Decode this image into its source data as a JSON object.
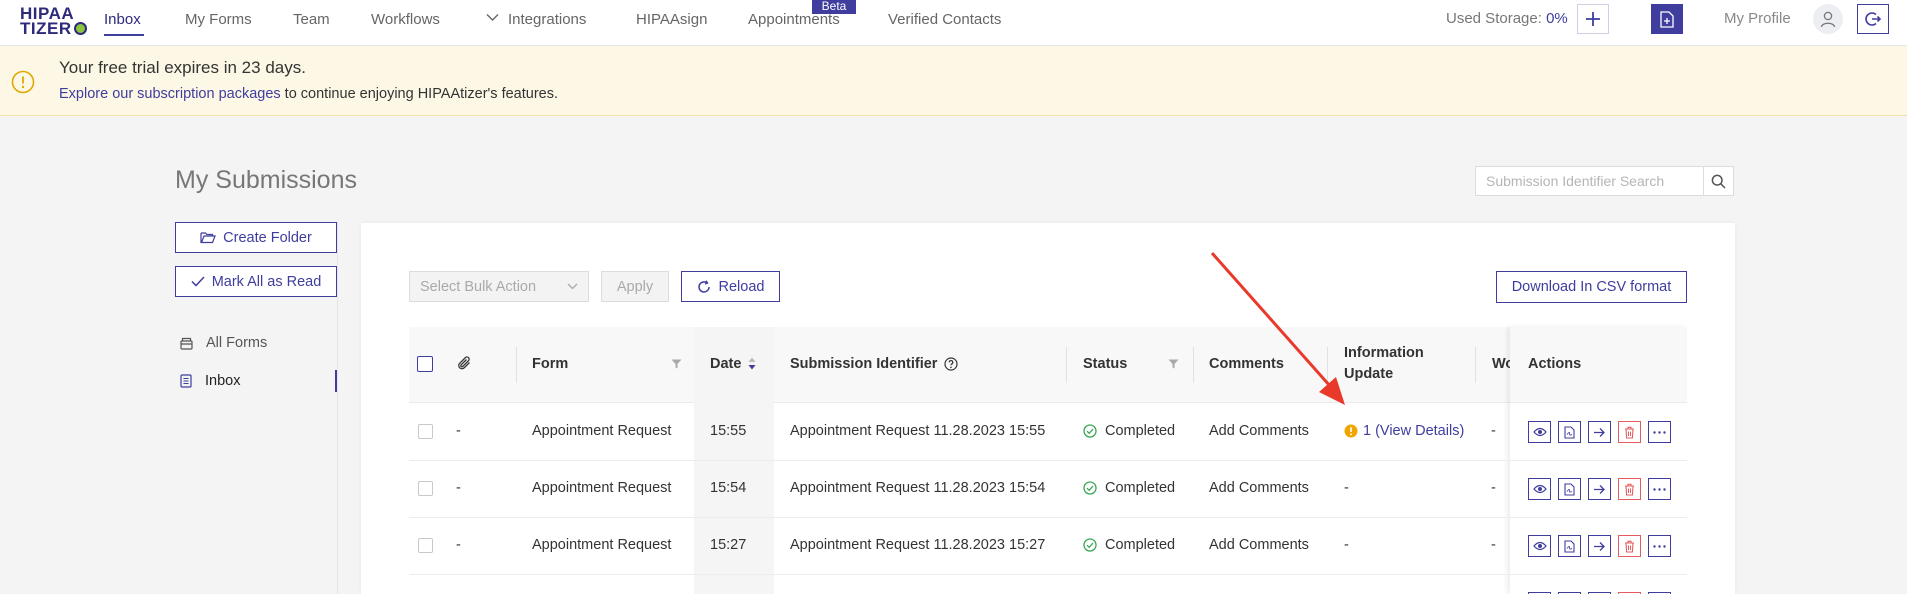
{
  "nav": {
    "logo_line1": "HIPAA",
    "logo_line2": "TIZER",
    "items": [
      {
        "label": "Inbox"
      },
      {
        "label": "My Forms"
      },
      {
        "label": "Team"
      },
      {
        "label": "Workflows"
      },
      {
        "label": "Integrations"
      },
      {
        "label": "HIPAAsign"
      },
      {
        "label": "Appointments"
      },
      {
        "label": "Verified Contacts"
      }
    ],
    "beta_badge": "Beta",
    "storage_label": "Used Storage:",
    "storage_value": "0%",
    "profile_label": "My Profile",
    "brand_color": "#3f3d9e",
    "logo_accent": "#8cc63f"
  },
  "banner": {
    "title": "Your free trial expires in 23 days.",
    "link_text": "Explore our subscription packages",
    "rest_text": " to continue enjoying HIPAAtizer's features.",
    "background": "#fdf8e6"
  },
  "page": {
    "title": "My Submissions",
    "search_placeholder": "Submission Identifier Search"
  },
  "sidebar": {
    "create_folder": "Create Folder",
    "mark_all_read": "Mark All as Read",
    "items": [
      {
        "label": "All Forms",
        "icon": "archive-icon"
      },
      {
        "label": "Inbox",
        "icon": "inbox-icon",
        "active": true
      }
    ]
  },
  "toolbar": {
    "bulk_action": "Select Bulk Action",
    "apply": "Apply",
    "reload": "Reload",
    "download_csv": "Download In CSV format"
  },
  "table": {
    "headers": {
      "form": "Form",
      "date": "Date",
      "submission_identifier": "Submission Identifier",
      "status": "Status",
      "comments": "Comments",
      "info_update_line1": "Information",
      "info_update_line2": "Update",
      "workflow_partial": "Wo",
      "actions": "Actions"
    },
    "rows": [
      {
        "attachment": "-",
        "form": "Appointment Request",
        "date": "15:55",
        "identifier": "Appointment Request 11.28.2023 15:55",
        "status": "Completed",
        "comments": "Add Comments",
        "info_update": "1 (View Details)",
        "workflow": "-"
      },
      {
        "attachment": "-",
        "form": "Appointment Request",
        "date": "15:54",
        "identifier": "Appointment Request 11.28.2023 15:54",
        "status": "Completed",
        "comments": "Add Comments",
        "info_update": "-",
        "workflow": "-"
      },
      {
        "attachment": "-",
        "form": "Appointment Request",
        "date": "15:27",
        "identifier": "Appointment Request 11.28.2023 15:27",
        "status": "Completed",
        "comments": "Add Comments",
        "info_update": "-",
        "workflow": "-"
      }
    ],
    "row_actions": [
      "eye-icon",
      "pdf-icon",
      "forward-icon",
      "trash-icon",
      "more-icon"
    ],
    "status_color": "#3aa655",
    "warning_color": "#f0a500",
    "delete_color": "#e65c5c",
    "annotation_arrow_color": "#e8392b"
  }
}
